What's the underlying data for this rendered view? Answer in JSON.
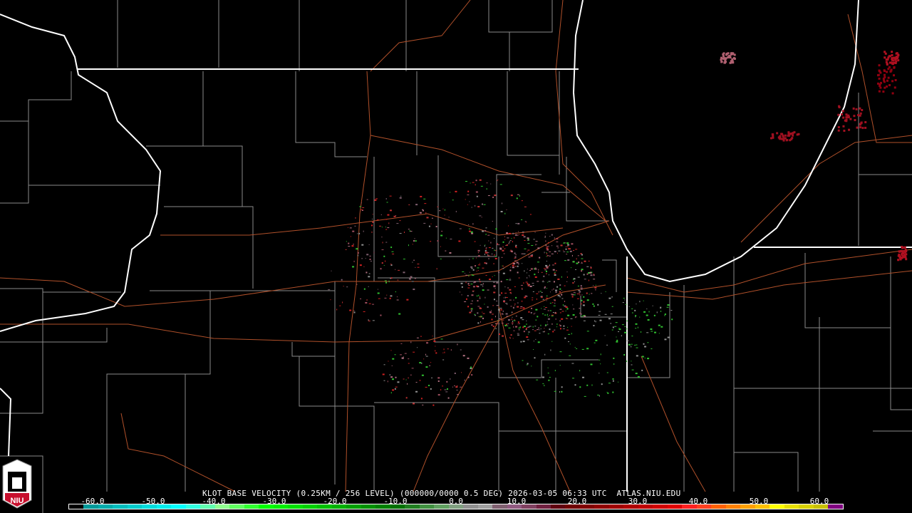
{
  "product": {
    "title": "KLOT BASE VELOCITY (0.25KM / 256 LEVEL) (000000/0000 0.5 DEG) 2026-03-05 06:33 UTC  ATLAS.NIU.EDU",
    "radar": "KLOT",
    "logo_text": "NIU"
  },
  "legend": {
    "unit_ticks": [
      "-60.0",
      "-50.0",
      "-40.0",
      "-30.0",
      "-20.0",
      "-10.0",
      "0.0",
      "10.0",
      "20.0",
      "30.0",
      "40.0",
      "50.0",
      "60.0"
    ],
    "tick_values": [
      -60,
      -50,
      -40,
      -30,
      -20,
      -10,
      0,
      10,
      20,
      30,
      40,
      50,
      60
    ],
    "range": [
      -64,
      64
    ],
    "colors": [
      "#000000",
      "#009a9a",
      "#00aaaa",
      "#00bcbc",
      "#00cccc",
      "#00dddd",
      "#00eeee",
      "#00ffff",
      "#30ffe0",
      "#60ffb0",
      "#90ff90",
      "#60ff60",
      "#30ff30",
      "#00ff00",
      "#00f000",
      "#00e000",
      "#00d000",
      "#00c000",
      "#00b000",
      "#00a000",
      "#009000",
      "#008000",
      "#007000",
      "#207e20",
      "#409040",
      "#60a060",
      "#80a080",
      "#909090",
      "#a0a0a0",
      "#806070",
      "#905a80",
      "#804060",
      "#702040",
      "#600010",
      "#700000",
      "#800000",
      "#900000",
      "#a00000",
      "#b00000",
      "#c00000",
      "#d00000",
      "#e00000",
      "#ff2020",
      "#ff4020",
      "#ff6000",
      "#ff8000",
      "#ffa000",
      "#ffc000",
      "#ffff00",
      "#e8e000",
      "#d8d000",
      "#c8c000",
      "#800080"
    ]
  }
}
